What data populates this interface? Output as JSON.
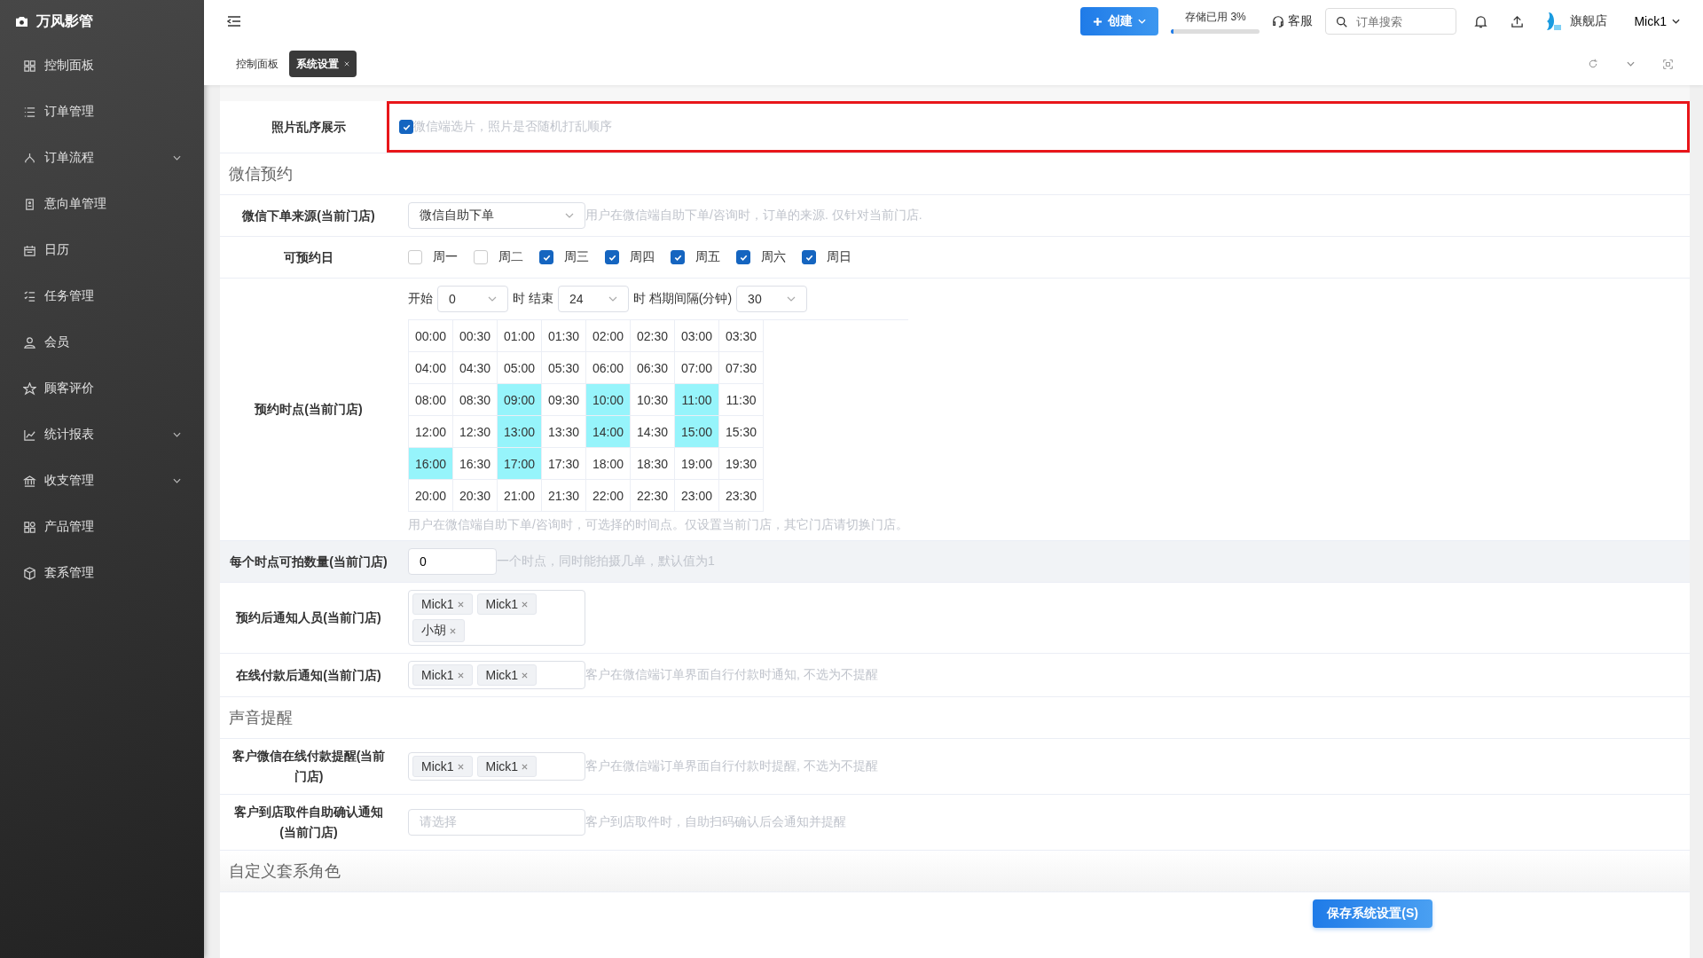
{
  "sidebar": {
    "brand": "万风影管",
    "items": [
      {
        "label": "控制面板",
        "expandable": false
      },
      {
        "label": "订单管理",
        "expandable": false
      },
      {
        "label": "订单流程",
        "expandable": true
      },
      {
        "label": "意向单管理",
        "expandable": false
      },
      {
        "label": "日历",
        "expandable": false
      },
      {
        "label": "任务管理",
        "expandable": false
      },
      {
        "label": "会员",
        "expandable": false
      },
      {
        "label": "顾客评价",
        "expandable": false
      },
      {
        "label": "统计报表",
        "expandable": true
      },
      {
        "label": "收支管理",
        "expandable": true
      },
      {
        "label": "产品管理",
        "expandable": false
      },
      {
        "label": "套系管理",
        "expandable": false
      }
    ]
  },
  "header": {
    "create_button": "创建",
    "storage": {
      "label": "存储已用 3%",
      "level": 0.03
    },
    "support": "客服",
    "search": {
      "placeholder": "订单搜索"
    },
    "store": "旗舰店",
    "user": "Mick1"
  },
  "tabs": [
    {
      "label": "控制面板",
      "selected": false,
      "closable": false
    },
    {
      "label": "系统设置",
      "selected": true,
      "closable": true
    }
  ],
  "form": [
    {
      "kind": "checkbox",
      "label": "照片乱序展示",
      "checked": true,
      "hint": "微信端选片，照片是否随机打乱顺序",
      "highlighted": true
    },
    {
      "kind": "section",
      "title": "微信预约",
      "shaded": false
    },
    {
      "kind": "select",
      "label": "微信下单来源(当前门店)",
      "value": "微信自助下单",
      "hint": "用户在微信端自助下单/咨询时，订单的来源. 仅针对当前门店."
    },
    {
      "kind": "days",
      "label": "可预约日",
      "days": [
        {
          "label": "周一",
          "checked": false
        },
        {
          "label": "周二",
          "checked": false
        },
        {
          "label": "周三",
          "checked": true
        },
        {
          "label": "周四",
          "checked": true
        },
        {
          "label": "周五",
          "checked": true
        },
        {
          "label": "周六",
          "checked": true
        },
        {
          "label": "周日",
          "checked": true
        }
      ]
    },
    {
      "kind": "slots",
      "label": "预约时点(当前门店)",
      "start_label": "开始",
      "start": "0",
      "end_label": "时 结束",
      "end": "24",
      "interval_label": "时 档期间隔(分钟)",
      "interval": "30",
      "hint": "用户在微信端自助下单/咨询时，可选择的时间点。仅设置当前门店，其它门店请切换门店。",
      "slots": [
        {
          "time": "00:00",
          "selected": false
        },
        {
          "time": "00:30",
          "selected": false
        },
        {
          "time": "01:00",
          "selected": false
        },
        {
          "time": "01:30",
          "selected": false
        },
        {
          "time": "02:00",
          "selected": false
        },
        {
          "time": "02:30",
          "selected": false
        },
        {
          "time": "03:00",
          "selected": false
        },
        {
          "time": "03:30",
          "selected": false
        },
        {
          "time": "04:00",
          "selected": false
        },
        {
          "time": "04:30",
          "selected": false
        },
        {
          "time": "05:00",
          "selected": false
        },
        {
          "time": "05:30",
          "selected": false
        },
        {
          "time": "06:00",
          "selected": false
        },
        {
          "time": "06:30",
          "selected": false
        },
        {
          "time": "07:00",
          "selected": false
        },
        {
          "time": "07:30",
          "selected": false
        },
        {
          "time": "08:00",
          "selected": false
        },
        {
          "time": "08:30",
          "selected": false
        },
        {
          "time": "09:00",
          "selected": true
        },
        {
          "time": "09:30",
          "selected": false
        },
        {
          "time": "10:00",
          "selected": true
        },
        {
          "time": "10:30",
          "selected": false
        },
        {
          "time": "11:00",
          "selected": true
        },
        {
          "time": "11:30",
          "selected": false
        },
        {
          "time": "12:00",
          "selected": false
        },
        {
          "time": "12:30",
          "selected": false
        },
        {
          "time": "13:00",
          "selected": true
        },
        {
          "time": "13:30",
          "selected": false
        },
        {
          "time": "14:00",
          "selected": true
        },
        {
          "time": "14:30",
          "selected": false
        },
        {
          "time": "15:00",
          "selected": true
        },
        {
          "time": "15:30",
          "selected": false
        },
        {
          "time": "16:00",
          "selected": true
        },
        {
          "time": "16:30",
          "selected": false
        },
        {
          "time": "17:00",
          "selected": true
        },
        {
          "time": "17:30",
          "selected": false
        },
        {
          "time": "18:00",
          "selected": false
        },
        {
          "time": "18:30",
          "selected": false
        },
        {
          "time": "19:00",
          "selected": false
        },
        {
          "time": "19:30",
          "selected": false
        },
        {
          "time": "20:00",
          "selected": false
        },
        {
          "time": "20:30",
          "selected": false
        },
        {
          "time": "21:00",
          "selected": false
        },
        {
          "time": "21:30",
          "selected": false
        },
        {
          "time": "22:00",
          "selected": false
        },
        {
          "time": "22:30",
          "selected": false
        },
        {
          "time": "23:00",
          "selected": false
        },
        {
          "time": "23:30",
          "selected": false
        }
      ]
    },
    {
      "kind": "number",
      "label": "每个时点可拍数量(当前门店)",
      "value": "0",
      "hint": "一个时点，同时能拍摄几单，默认值为1",
      "shaded": true
    },
    {
      "kind": "tags",
      "label": "预约后通知人员(当前门店)",
      "tags": [
        "Mick1",
        "Mick1",
        "小胡"
      ]
    },
    {
      "kind": "tags",
      "label": "在线付款后通知(当前门店)",
      "tags": [
        "Mick1",
        "Mick1"
      ],
      "hint": "客户在微信端订单界面自行付款时通知, 不选为不提醒"
    },
    {
      "kind": "section",
      "title": "声音提醒",
      "shaded": false
    },
    {
      "kind": "tags",
      "label": "客户微信在线付款提醒(当前门店)",
      "tags": [
        "Mick1",
        "Mick1"
      ],
      "hint": "客户在微信端订单界面自行付款时提醒, 不选为不提醒"
    },
    {
      "kind": "tags",
      "label": "客户到店取件自助确认通知(当前门店)",
      "placeholder": "请选择",
      "hint": "客户到店取件时，自助扫码确认后会通知并提醒"
    },
    {
      "kind": "section",
      "title": "自定义套系角色",
      "shaded": true
    }
  ],
  "save_button": "保存系统设置(S)"
}
